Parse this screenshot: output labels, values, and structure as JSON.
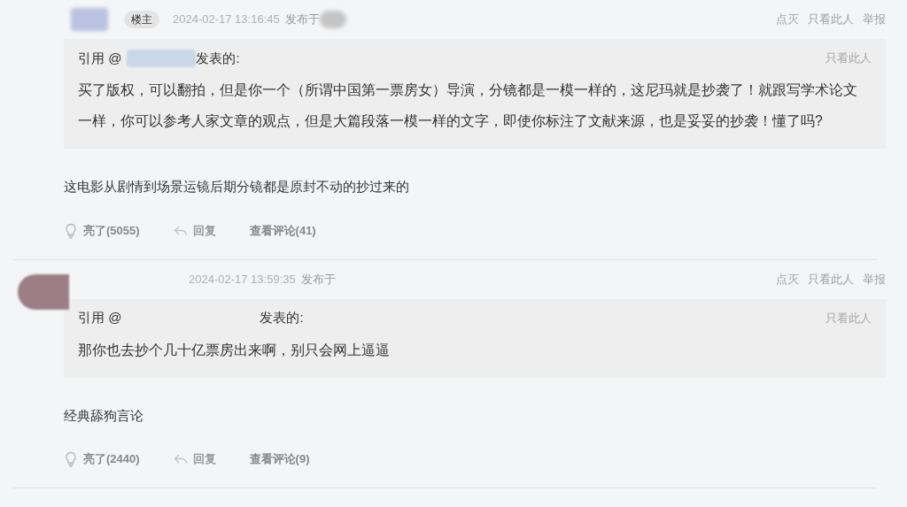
{
  "posts": [
    {
      "badge": "楼主",
      "timestamp": "2024-02-17 13:16:45",
      "posted_label": "发布于",
      "actions": [
        "点灭",
        "只看此人",
        "举报"
      ],
      "quote": {
        "prefix": "引用 @",
        "suffix": "发表的:",
        "action": "只看此人",
        "text": "买了版权，可以翻拍，但是你一个（所谓中国第一票房女）导演，分镜都是一模一样的，这尼玛就是抄袭了！就跟写学术论文一样，你可以参考人家文章的观点，但是大篇段落一模一样的文字，即使你标注了文献来源，也是妥妥的抄袭！懂了吗?"
      },
      "body": "这电影从剧情到场景运镜后期分镜都是原封不动的抄过来的",
      "footer": {
        "like": "亮了(5055)",
        "reply": "回复",
        "comments": "查看评论(41)"
      }
    },
    {
      "timestamp": "2024-02-17 13:59:35",
      "posted_label": "发布于",
      "actions": [
        "点灭",
        "只看此人",
        "举报"
      ],
      "quote": {
        "prefix": "引用 @",
        "suffix": "发表的:",
        "action": "只看此人",
        "text": "那你也去抄个几十亿票房出来啊，别只会网上逼逼"
      },
      "body": "经典舔狗言论",
      "footer": {
        "like": "亮了(2440)",
        "reply": "回复",
        "comments": "查看评论(9)"
      }
    }
  ]
}
